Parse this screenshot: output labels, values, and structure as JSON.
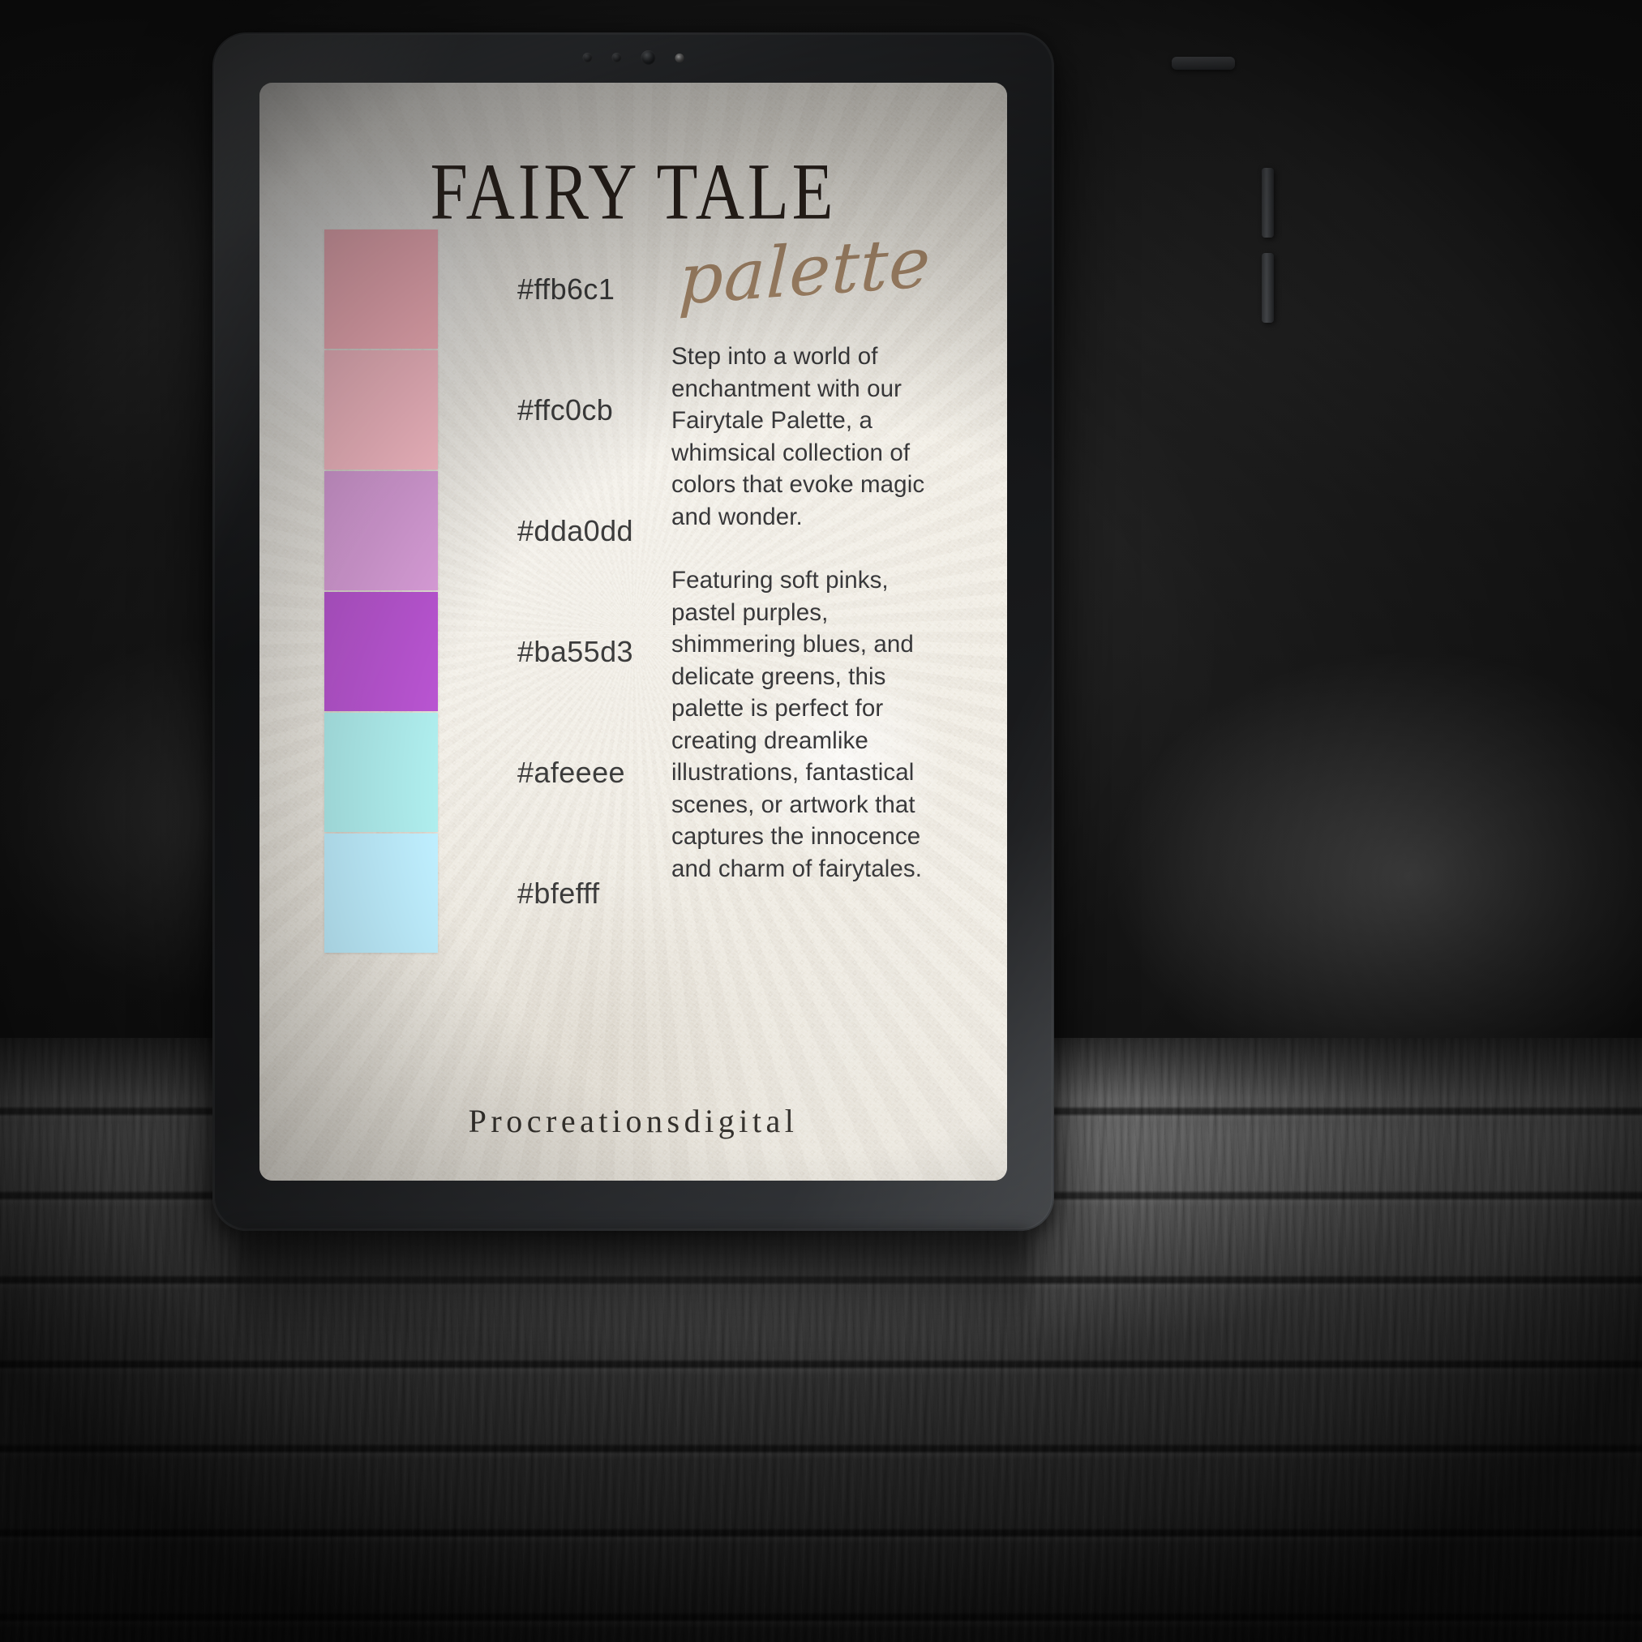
{
  "scene": {
    "device": "tablet",
    "surface": "dark wooden table",
    "background": "dark studio backdrop"
  },
  "card": {
    "title": "FAIRY TALE",
    "script_word": "palette",
    "footer": "Procreationsdigital",
    "paper_color": "#efebe2",
    "title_color": "#2b221c",
    "script_color": "#a98a6b",
    "body_text_color": "#38383a",
    "paragraphs": [
      "Step into a world of enchantment with our Fairytale Palette, a whimsical collection of colors that evoke magic and wonder.",
      " Featuring soft pinks, pastel purples, shimmering blues, and delicate greens, this palette is perfect for creating dreamlike illustrations, fantastical scenes, or artwork that captures the innocence and charm of fairytales."
    ]
  },
  "swatches": [
    {
      "hex": "#ffb6c1",
      "label": "#ffb6c1",
      "name": "light-pink"
    },
    {
      "hex": "#ffc0cb",
      "label": "#ffc0cb",
      "name": "pink"
    },
    {
      "hex": "#dda0dd",
      "label": "#dda0dd",
      "name": "plum"
    },
    {
      "hex": "#ba55d3",
      "label": "#ba55d3",
      "name": "medium-orchid"
    },
    {
      "hex": "#afeeee",
      "label": "#afeeee",
      "name": "pale-turquoise"
    },
    {
      "hex": "#bfefff",
      "label": "#bfefff",
      "name": "light-blue"
    }
  ],
  "hardware": {
    "camera_dots": [
      "cam-dot",
      "cam-dot",
      "lens",
      "sensor"
    ],
    "buttons": [
      "power-button",
      "volume-up-button",
      "volume-down-button"
    ]
  }
}
